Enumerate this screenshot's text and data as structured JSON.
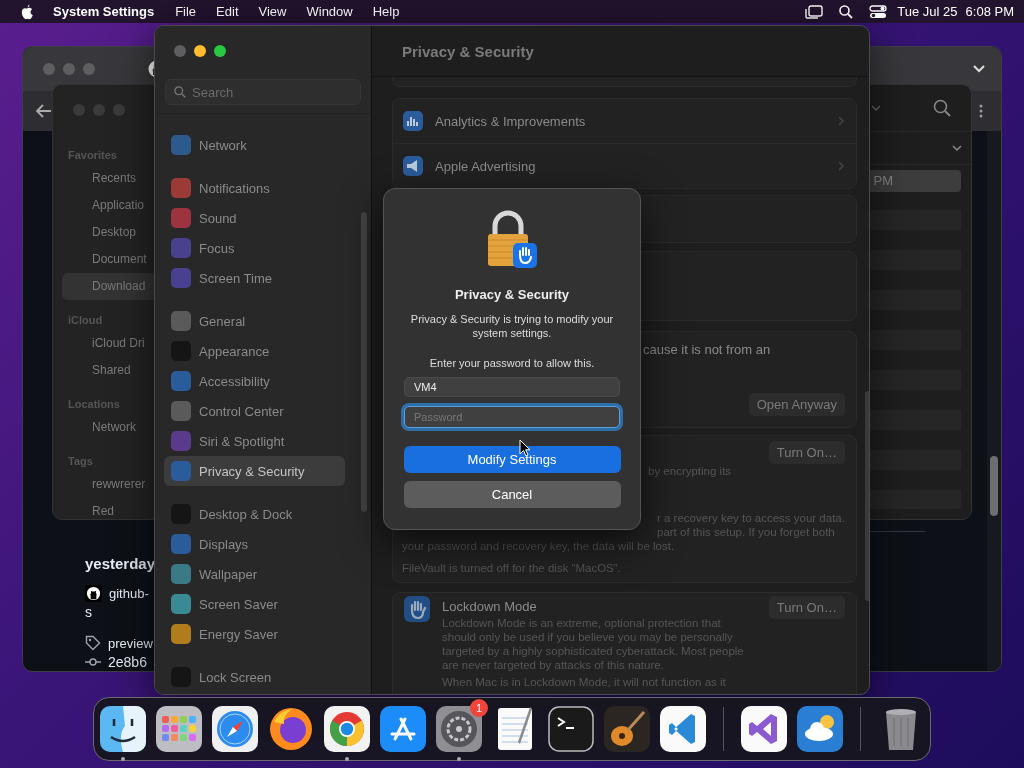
{
  "menu_bar": {
    "app": "System Settings",
    "menus": [
      "File",
      "Edit",
      "View",
      "Window",
      "Help"
    ],
    "date": "Tue Jul 25",
    "time": "6:08 PM"
  },
  "browser_window": {
    "items": [
      {
        "kind": "heading",
        "text": "yesterday"
      },
      {
        "kind": "repo",
        "text": "github-"
      },
      {
        "kind": "plain",
        "text": "s"
      },
      {
        "kind": "tag",
        "text": "preview"
      },
      {
        "kind": "commit",
        "text": "2e8b6"
      }
    ]
  },
  "finder_window": {
    "sidebar": [
      {
        "heading": "Favorites",
        "items": [
          {
            "label": "Recents",
            "selected": false
          },
          {
            "label": "Applicatio",
            "selected": false
          },
          {
            "label": "Desktop",
            "selected": false
          },
          {
            "label": "Document",
            "selected": false
          },
          {
            "label": "Download",
            "selected": true
          }
        ]
      },
      {
        "heading": "iCloud",
        "items": [
          {
            "label": "iCloud Dri",
            "selected": false
          },
          {
            "label": "Shared",
            "selected": false
          }
        ]
      },
      {
        "heading": "Locations",
        "items": [
          {
            "label": "Network",
            "selected": false
          }
        ]
      },
      {
        "heading": "Tags",
        "items": [
          {
            "label": "rewwrerer",
            "selected": false
          },
          {
            "label": "Red",
            "selected": false
          }
        ]
      }
    ],
    "rows": [
      {
        "text": "PM",
        "selected": true
      }
    ]
  },
  "settings_window": {
    "search": {
      "placeholder": "Search"
    },
    "sidebar": [
      [
        {
          "label": "Network",
          "color": "#2d5a8c",
          "selected": false
        }
      ],
      [
        {
          "label": "Notifications",
          "color": "#9c3a36",
          "selected": false
        },
        {
          "label": "Sound",
          "color": "#9c3440",
          "selected": false
        },
        {
          "label": "Focus",
          "color": "#4a4090",
          "selected": false
        },
        {
          "label": "Screen Time",
          "color": "#4a4090",
          "selected": false
        }
      ],
      [
        {
          "label": "General",
          "color": "#5a5a5a",
          "selected": false
        },
        {
          "label": "Appearance",
          "color": "#151515",
          "selected": false
        },
        {
          "label": "Accessibility",
          "color": "#2a5c9c",
          "selected": false
        },
        {
          "label": "Control Center",
          "color": "#5a5a5a",
          "selected": false
        },
        {
          "label": "Siri & Spotlight",
          "color": "#5a3a8a",
          "selected": false
        },
        {
          "label": "Privacy & Security",
          "color": "#2a5c9c",
          "selected": true
        }
      ],
      [
        {
          "label": "Desktop & Dock",
          "color": "#151515",
          "selected": false
        },
        {
          "label": "Displays",
          "color": "#2a5c9c",
          "selected": false
        },
        {
          "label": "Wallpaper",
          "color": "#3a7a86",
          "selected": false
        },
        {
          "label": "Screen Saver",
          "color": "#3a8a96",
          "selected": false
        },
        {
          "label": "Energy Saver",
          "color": "#b07c1c",
          "selected": false
        }
      ],
      [
        {
          "label": "Lock Screen",
          "color": "#151515",
          "selected": false
        }
      ]
    ],
    "title": "Privacy & Security",
    "rows": [
      {
        "label": "Analytics & Improvements"
      },
      {
        "label": "Apple Advertising"
      }
    ],
    "security": {
      "text": "cause it is not from an",
      "button": "Open Anyway"
    },
    "filevault": {
      "button": "Turn On…",
      "description": "by encrypting its",
      "warning": [
        "r a recovery key to access your data.",
        "part of this setup. If you forget both",
        "your password and recovery key, the data will be lost."
      ],
      "status": "FileVault is turned off for the disk “MacOS”."
    },
    "lockdown": {
      "title": "Lockdown Mode",
      "button": "Turn On…",
      "description": "Lockdown Mode is an extreme, optional protection that should only be used if you believe you may be personally targeted by a highly sophisticated cyberattack. Most people are never targeted by attacks of this nature.",
      "note": "When Mac is in Lockdown Mode, it will not function as it"
    }
  },
  "dialog": {
    "title": "Privacy & Security",
    "message": "Privacy & Security is trying to modify your system settings.",
    "prompt": "Enter your password to allow this.",
    "username": "VM4",
    "password": {
      "placeholder": "Password",
      "focused": true
    },
    "buttons": [
      {
        "label": "Modify Settings",
        "default": true
      },
      {
        "label": "Cancel",
        "default": false
      }
    ]
  },
  "dock": [
    {
      "kind": "app",
      "running": true
    },
    {
      "kind": "app",
      "running": false
    },
    {
      "kind": "app",
      "running": false
    },
    {
      "kind": "app",
      "running": false
    },
    {
      "kind": "app",
      "running": true
    },
    {
      "kind": "app",
      "running": false
    },
    {
      "kind": "app",
      "running": true,
      "badge": "1"
    },
    {
      "kind": "app",
      "running": false
    },
    {
      "kind": "app",
      "running": false
    },
    {
      "kind": "app",
      "running": false
    },
    {
      "kind": "app",
      "running": false
    },
    {
      "kind": "separator"
    },
    {
      "kind": "app",
      "running": false
    },
    {
      "kind": "app",
      "running": false
    },
    {
      "kind": "separator"
    },
    {
      "kind": "app",
      "running": false
    }
  ]
}
